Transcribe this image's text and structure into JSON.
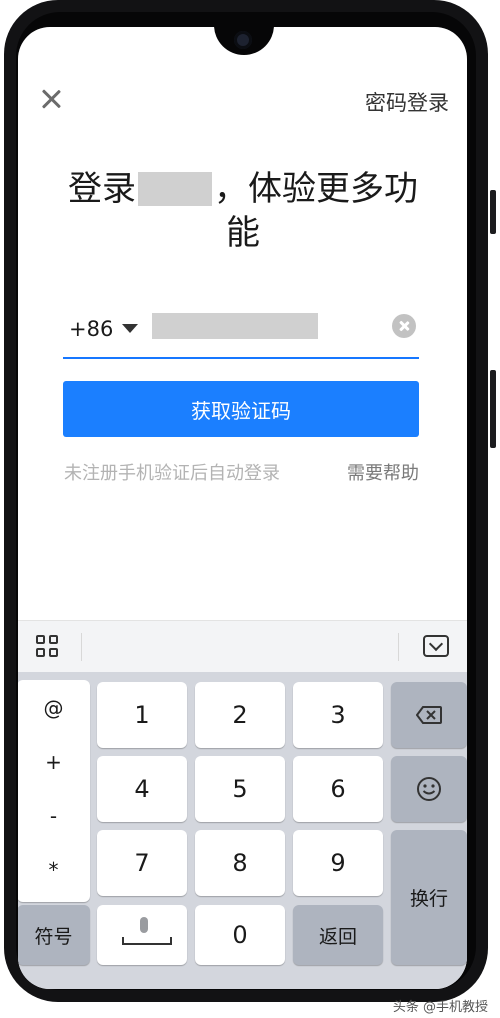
{
  "topbar": {
    "password_login": "密码登录"
  },
  "title": {
    "prefix": "登录",
    "suffix": "，体验更多功能"
  },
  "phone": {
    "country_code": "+86",
    "input_value": ""
  },
  "actions": {
    "get_code": "获取验证码",
    "hint": "未注册手机验证后自动登录",
    "help": "需要帮助"
  },
  "keyboard": {
    "symbols": [
      "@",
      "+",
      "-",
      "*"
    ],
    "digits": [
      "1",
      "2",
      "3",
      "4",
      "5",
      "6",
      "7",
      "8",
      "9",
      "0"
    ],
    "symbol_key": "符号",
    "back_key": "返回",
    "enter_key": "换行"
  },
  "watermark": "头条 @手机教授",
  "colors": {
    "accent": "#1b7fff",
    "keyboard_bg": "#d3d6dd",
    "function_key": "#aeb4bf"
  }
}
